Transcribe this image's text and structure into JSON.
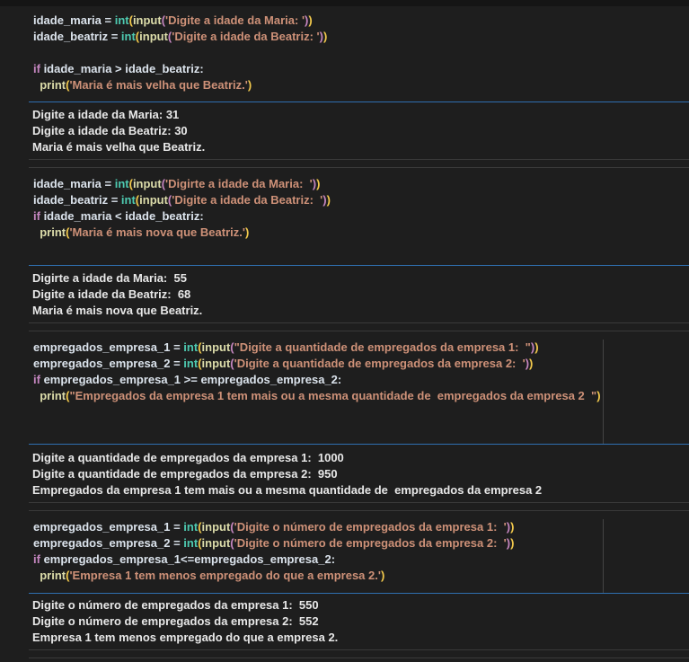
{
  "cells": [
    {
      "code": [
        [
          "idade_maria = ",
          "int",
          "(",
          "input",
          "(",
          "'Digite a idade da Maria: '",
          ")",
          ")"
        ],
        [
          "idade_beatriz = ",
          "int",
          "(",
          "input",
          "(",
          "'Digite a idade da Beatriz: '",
          ")",
          ")"
        ],
        [
          "if",
          " idade_maria > idade_beatriz:"
        ],
        [
          "print",
          "(",
          "'Maria é mais velha que Beatriz.'",
          ")"
        ]
      ],
      "output": [
        "Digite a idade da Maria: 31",
        "Digite a idade da Beatriz: 30",
        "Maria é mais velha que Beatriz."
      ]
    },
    {
      "code": [
        [
          "idade_maria = ",
          "int",
          "(",
          "input",
          "(",
          "'Digirte a idade da Maria:  '",
          ")",
          ")"
        ],
        [
          "idade_beatriz = ",
          "int",
          "(",
          "input",
          "(",
          "'Digite a idade da Beatriz:  '",
          ")",
          ")"
        ],
        [
          "if",
          " idade_maria < idade_beatriz:"
        ],
        [
          "print",
          "(",
          "'Maria é mais nova que Beatriz.'",
          ")"
        ]
      ],
      "output": [
        "Digirte a idade da Maria:  55",
        "Digite a idade da Beatriz:  68",
        "Maria é mais nova que Beatriz."
      ]
    },
    {
      "code": [
        [
          "empregados_empresa_1 = ",
          "int",
          "(",
          "input",
          "(",
          "\"Digite a quantidade de empregados da empresa 1:  \"",
          ")",
          ")"
        ],
        [
          "empregados_empresa_2 = ",
          "int",
          "(",
          "input",
          "(",
          "'Digite a quantidade de empregados da empresa 2:  '",
          ")",
          ")"
        ],
        [
          "if",
          " empregados_empresa_1 >= empregados_empresa_2:"
        ],
        [
          "print",
          "(",
          "\"Empregados da empresa 1 tem mais ou a mesma quantidade de  empregados da empresa 2  \"",
          ")"
        ]
      ],
      "output": [
        "Digite a quantidade de empregados da empresa 1:  1000",
        "Digite a quantidade de empregados da empresa 2:  950",
        "Empregados da empresa 1 tem mais ou a mesma quantidade de  empregados da empresa 2"
      ]
    },
    {
      "code": [
        [
          "empregados_empresa_1 = ",
          "int",
          "(",
          "input",
          "(",
          "'Digite o número de empregados da empresa 1:  '",
          ")",
          ")"
        ],
        [
          "empregados_empresa_2 = ",
          "int",
          "(",
          "input",
          "(",
          "'Digite o número de empregados da empresa 2:  '",
          ")",
          ")"
        ],
        [
          "if",
          " empregados_empresa_1<=empregados_empresa_2:"
        ],
        [
          "print",
          "(",
          "'Empresa 1 tem menos empregado do que a empresa 2.'",
          ")"
        ]
      ],
      "output": [
        "Digite o número de empregados da empresa 1:  550",
        "Digite o número de empregados da empresa 2:  552",
        "Empresa 1 tem menos empregado do que a empresa 2."
      ]
    }
  ]
}
